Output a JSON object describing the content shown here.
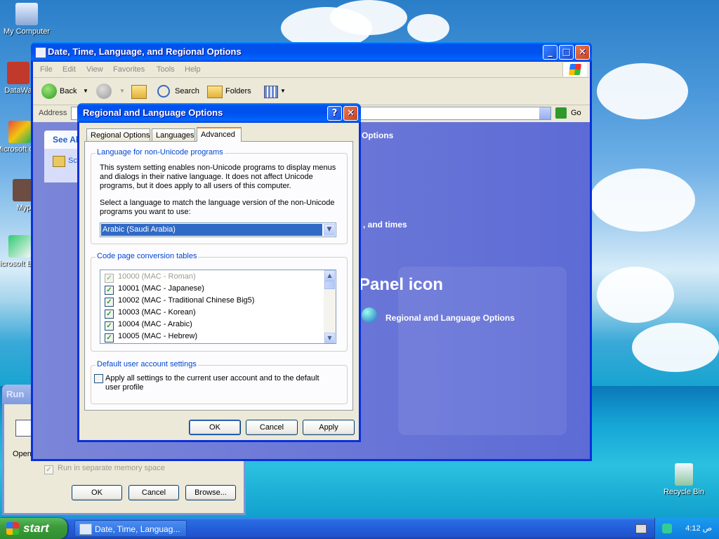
{
  "desktop": {
    "icons": [
      {
        "label": "My Computer"
      },
      {
        "label": "DataWa"
      },
      {
        "label": "Microsoft C++"
      },
      {
        "label": "Myp"
      },
      {
        "label": "Microsoft Basic"
      },
      {
        "label": "Recycle Bin"
      }
    ]
  },
  "explorer": {
    "title": "Date, Time, Language, and Regional Options",
    "menu": [
      "File",
      "Edit",
      "View",
      "Favorites",
      "Tools",
      "Help"
    ],
    "toolbar": {
      "back": "Back",
      "search": "Search",
      "folders": "Folders"
    },
    "address_label": "Address",
    "go_label": "Go",
    "see_also": "See Als",
    "see_also_item": "Sch",
    "pick_task_fragment": "Options",
    "task_fragment": ", and times",
    "cp_heading": "Panel icon",
    "cp_link": "Regional and Language Options"
  },
  "run": {
    "title": "Run",
    "open_label": "Open",
    "checkbox_label": "Run in separate memory space",
    "ok": "OK",
    "cancel": "Cancel",
    "browse": "Browse..."
  },
  "dialog": {
    "title": "Regional and Language Options",
    "help": "?",
    "tabs": [
      "Regional Options",
      "Languages",
      "Advanced"
    ],
    "active_tab": "Advanced",
    "non_unicode": {
      "label": "Language for non-Unicode programs",
      "desc_lines": [
        "This system setting enables non-Unicode programs to display menus",
        "and dialogs in their native language. It does not affect Unicode",
        "programs, but it does apply to all users of this computer."
      ],
      "select_lines": [
        "Select a language to match the language version of the non-Unicode",
        "programs you want to use:"
      ],
      "selected": "Arabic (Saudi Arabia)"
    },
    "code_pages": {
      "label": "Code page conversion tables",
      "items": [
        {
          "text": "10000 (MAC - Roman)",
          "checked": true,
          "disabled": true
        },
        {
          "text": "10001 (MAC - Japanese)",
          "checked": true,
          "disabled": false
        },
        {
          "text": "10002 (MAC - Traditional Chinese Big5)",
          "checked": true,
          "disabled": false
        },
        {
          "text": "10003 (MAC - Korean)",
          "checked": true,
          "disabled": false
        },
        {
          "text": "10004 (MAC - Arabic)",
          "checked": true,
          "disabled": false
        },
        {
          "text": "10005 (MAC - Hebrew)",
          "checked": true,
          "disabled": false
        }
      ]
    },
    "default_user": {
      "label": "Default user account settings",
      "checkbox_lines": [
        "Apply all settings to the current user account and to the default",
        "user profile"
      ]
    },
    "buttons": {
      "ok": "OK",
      "cancel": "Cancel",
      "apply": "Apply"
    }
  },
  "taskbar": {
    "start": "start",
    "task_button": "Date, Time, Languag...",
    "clock": "4:12 ص"
  }
}
